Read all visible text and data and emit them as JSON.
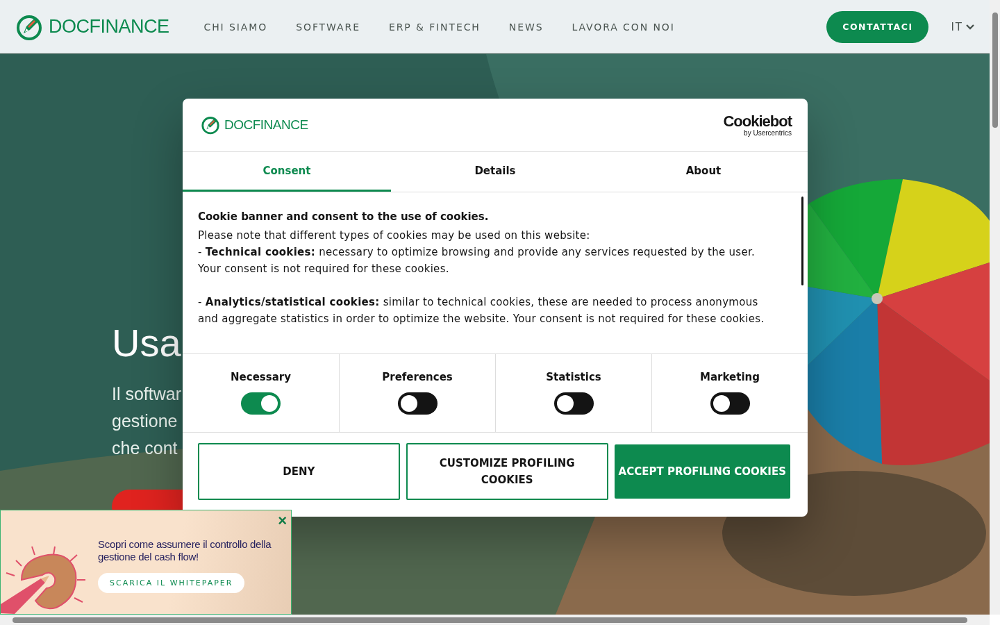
{
  "header": {
    "logo_text": "DOCFINANCE",
    "nav": [
      "CHI SIAMO",
      "SOFTWARE",
      "ERP & FINTECH",
      "NEWS",
      "LAVORA CON NOI"
    ],
    "contact_button": "CONTATTACI",
    "language": "IT"
  },
  "hero": {
    "title": "Usa",
    "lines": [
      "Il softwar",
      "gestione",
      "che cont"
    ]
  },
  "cookie_dialog": {
    "logo_text": "DOCFINANCE",
    "brand": "Cookiebot",
    "brand_sub": "by Usercentrics",
    "tabs": [
      {
        "label": "Consent",
        "selected": true
      },
      {
        "label": "Details",
        "selected": false
      },
      {
        "label": "About",
        "selected": false
      }
    ],
    "heading": "Cookie banner and consent to the use of cookies.",
    "paragraph_groups": [
      [
        "Please note that different types of cookies may be used on this website:",
        "- **Technical cookies:** necessary to optimize browsing and provide any services requested by the user. Your consent is not required for these cookies."
      ],
      [
        "- **Analytics/statistical cookies:** similar to technical cookies, these are needed to process anonymous and aggregate statistics in order to optimize the website. Your consent is not required for these cookies."
      ]
    ],
    "categories": [
      {
        "label": "Necessary",
        "on": true
      },
      {
        "label": "Preferences",
        "on": false
      },
      {
        "label": "Statistics",
        "on": false
      },
      {
        "label": "Marketing",
        "on": false
      }
    ],
    "buttons": [
      {
        "label": "DENY",
        "kind": "outline"
      },
      {
        "label": "CUSTOMIZE PROFILING COOKIES",
        "kind": "outline"
      },
      {
        "label": "ACCEPT PROFILING COOKIES",
        "kind": "filled"
      }
    ]
  },
  "promo": {
    "close": "×",
    "text": "Scopri come assumere il controllo della gestione del cash flow!",
    "button": "SCARICA IL WHITEPAPER"
  }
}
